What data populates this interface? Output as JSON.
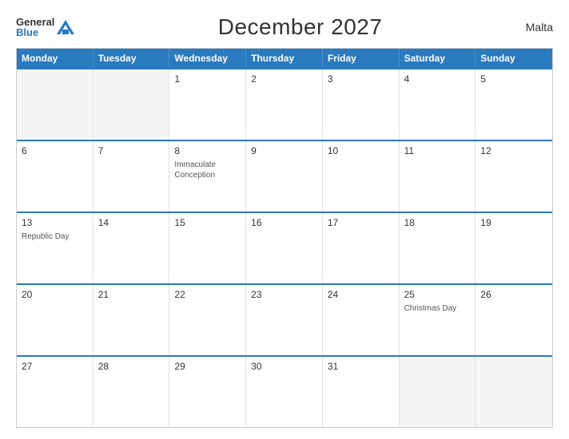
{
  "header": {
    "logo_general": "General",
    "logo_blue": "Blue",
    "title": "December 2027",
    "country": "Malta"
  },
  "weekdays": [
    "Monday",
    "Tuesday",
    "Wednesday",
    "Thursday",
    "Friday",
    "Saturday",
    "Sunday"
  ],
  "rows": [
    [
      {
        "day": "",
        "empty": true
      },
      {
        "day": "",
        "empty": true
      },
      {
        "day": "1",
        "empty": false,
        "event": ""
      },
      {
        "day": "2",
        "empty": false,
        "event": ""
      },
      {
        "day": "3",
        "empty": false,
        "event": ""
      },
      {
        "day": "4",
        "empty": false,
        "event": ""
      },
      {
        "day": "5",
        "empty": false,
        "event": ""
      }
    ],
    [
      {
        "day": "6",
        "empty": false,
        "event": ""
      },
      {
        "day": "7",
        "empty": false,
        "event": ""
      },
      {
        "day": "8",
        "empty": false,
        "event": "Immaculate Conception"
      },
      {
        "day": "9",
        "empty": false,
        "event": ""
      },
      {
        "day": "10",
        "empty": false,
        "event": ""
      },
      {
        "day": "11",
        "empty": false,
        "event": ""
      },
      {
        "day": "12",
        "empty": false,
        "event": ""
      }
    ],
    [
      {
        "day": "13",
        "empty": false,
        "event": "Republic Day"
      },
      {
        "day": "14",
        "empty": false,
        "event": ""
      },
      {
        "day": "15",
        "empty": false,
        "event": ""
      },
      {
        "day": "16",
        "empty": false,
        "event": ""
      },
      {
        "day": "17",
        "empty": false,
        "event": ""
      },
      {
        "day": "18",
        "empty": false,
        "event": ""
      },
      {
        "day": "19",
        "empty": false,
        "event": ""
      }
    ],
    [
      {
        "day": "20",
        "empty": false,
        "event": ""
      },
      {
        "day": "21",
        "empty": false,
        "event": ""
      },
      {
        "day": "22",
        "empty": false,
        "event": ""
      },
      {
        "day": "23",
        "empty": false,
        "event": ""
      },
      {
        "day": "24",
        "empty": false,
        "event": ""
      },
      {
        "day": "25",
        "empty": false,
        "event": "Christmas Day"
      },
      {
        "day": "26",
        "empty": false,
        "event": ""
      }
    ],
    [
      {
        "day": "27",
        "empty": false,
        "event": ""
      },
      {
        "day": "28",
        "empty": false,
        "event": ""
      },
      {
        "day": "29",
        "empty": false,
        "event": ""
      },
      {
        "day": "30",
        "empty": false,
        "event": ""
      },
      {
        "day": "31",
        "empty": false,
        "event": ""
      },
      {
        "day": "",
        "empty": true
      },
      {
        "day": "",
        "empty": true
      }
    ]
  ]
}
